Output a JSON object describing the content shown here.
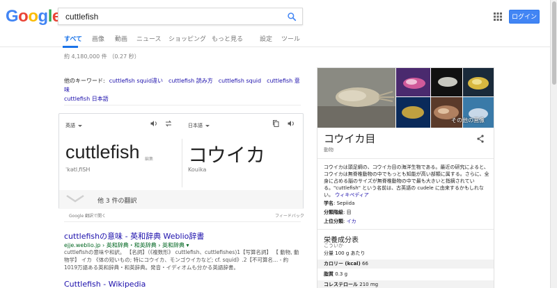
{
  "header": {
    "logo": [
      "G",
      "o",
      "o",
      "g",
      "l",
      "e"
    ],
    "search_value": "cuttlefish",
    "login_label": "ログイン"
  },
  "tabs": [
    {
      "label": "すべて",
      "active": true
    },
    {
      "label": "画像"
    },
    {
      "label": "動画"
    },
    {
      "label": "ニュース"
    },
    {
      "label": "ショッピング"
    },
    {
      "label": "もっと見る"
    },
    {
      "label": "設定"
    },
    {
      "label": "ツール"
    }
  ],
  "stats": "約 4,180,000 件 （0.27 秒）",
  "keywords": {
    "label": "他のキーワード:",
    "links": [
      "cuttlefish squid違い",
      "cuttlefish 読み方",
      "cuttlefish squid",
      "cuttlefish 意味",
      "cuttlefish 日本語"
    ]
  },
  "translate": {
    "source_lang": "英語",
    "target_lang": "日本語",
    "source_word": "cuttlefish",
    "edit_label": "編集",
    "phonetic": "ˈkətlˌfiSH",
    "target_word": "コウイカ",
    "romaji": "Kouika",
    "more_label": "他 3 件の翻訳",
    "footer_left": "Google 翻訳で開く",
    "footer_right": "フィードバック"
  },
  "results": [
    {
      "title": "cuttlefishの意味 - 英和辞典 Weblio辞書",
      "url": "ejje.weblio.jp › 英和辞典・和英辞典 › 英和辞典 ▾",
      "snippet": "cuttlefishの意味や和訳。 【名詞】（《複数形》 cuttlefish、cuttlefishes)1【写算名詞】 【 動物, 動物学】 イカ 《体の短いもの; 特にコウイカ、モンゴウイカなど; cf. squid》.2【不可算名... - 約1019万語ある英和辞典・和英辞典。発音・イディオムも分かる英語辞書。"
    },
    {
      "title": "Cuttlefish - Wikipedia",
      "url": "",
      "snippet": ""
    }
  ],
  "knowledge_panel": {
    "more_images": "その他の画像",
    "title": "コウイカ目",
    "subtitle": "動物",
    "description": "コウイカは頭足綱の、コウイカ目の海洋生物である。最近の研究によると、コウイカは無脊椎動物の中でもっとも知能が高い部類に属する。さらに、全身に占める脳のサイズが無脊椎動物の中で最も大きいと指摘されている。\"cuttlefish\" という名前は、古英語の cudele に由来するかもしれない。",
    "description_link": "ウィキペディア",
    "facts": [
      {
        "key": "学名",
        "value": "Sepiida",
        "link": false
      },
      {
        "key": "分類階級",
        "value": "目",
        "link": false
      },
      {
        "key": "上位分類",
        "value": "イカ",
        "link": true
      }
    ],
    "nutrition_title": "栄養成分表",
    "nutrition_sub": "こういか",
    "nutrition": [
      {
        "key": "分量",
        "value": "100 g あたり",
        "bold": false
      },
      {
        "key": "カロリー (kcal)",
        "value": "66",
        "bold": true
      },
      {
        "key": "脂質",
        "value": "0.3 g",
        "bold": true
      },
      {
        "key": "コレステロール",
        "value": "210 mg",
        "bold": true
      }
    ]
  },
  "colors": {
    "link": "#1a0dab",
    "url_green": "#006621",
    "accent_blue": "#4285f4"
  }
}
